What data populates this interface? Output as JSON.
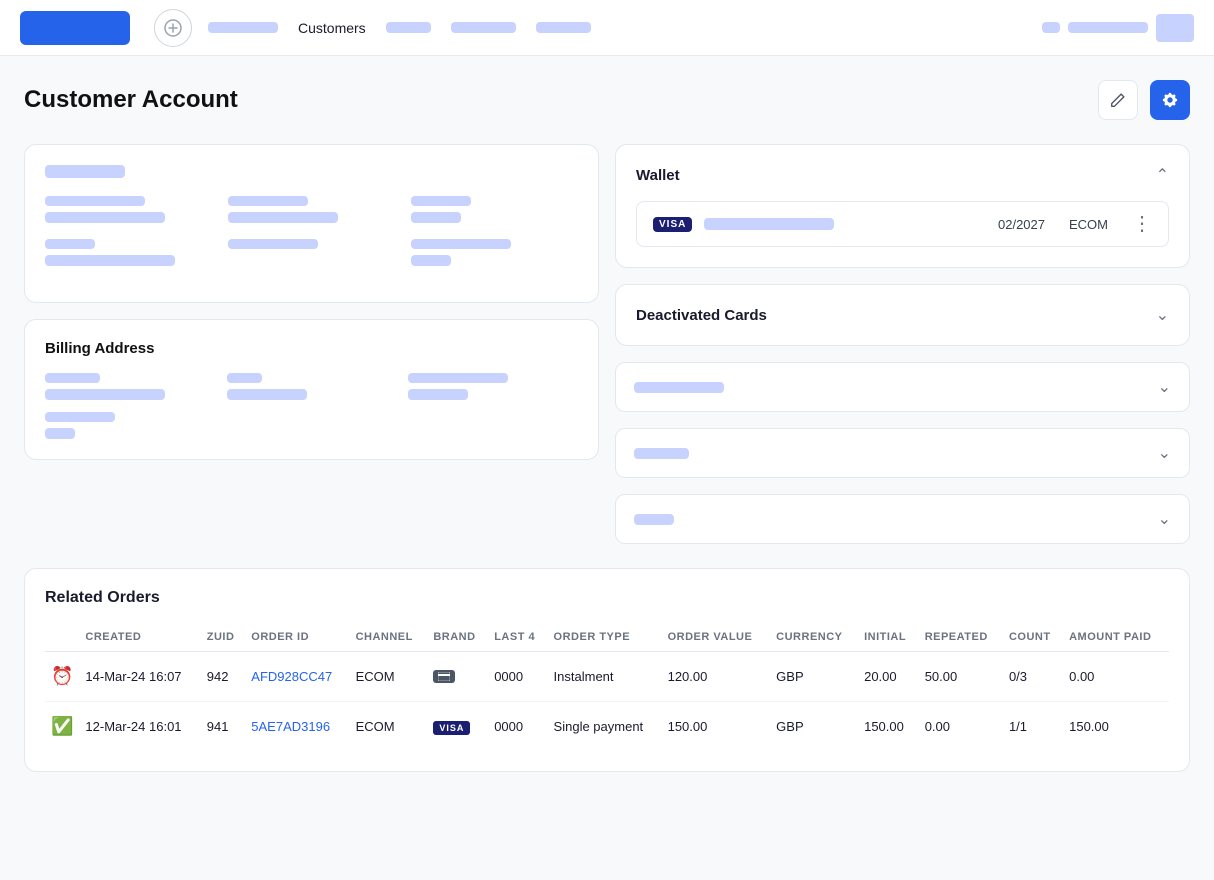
{
  "nav": {
    "add_label": "+",
    "active_item": "Customers",
    "item1_w": 70,
    "item2_w": 55,
    "item3_w": 65,
    "item4_w": 50,
    "right1_w": 70,
    "right2_w": 90
  },
  "page": {
    "title": "Customer Account",
    "edit_icon": "✏",
    "settings_icon": "⚙"
  },
  "wallet": {
    "title": "Wallet",
    "card": {
      "network": "VISA",
      "expiry": "02/2027",
      "type": "ECOM",
      "menu": "⋮"
    }
  },
  "deactivated": {
    "title": "Deactivated Cards"
  },
  "billing": {
    "title": "Billing Address"
  },
  "related_orders": {
    "title": "Related Orders",
    "columns": [
      "CREATED",
      "ZUID",
      "ORDER ID",
      "CHANNEL",
      "BRAND",
      "LAST 4",
      "ORDER TYPE",
      "ORDER VALUE",
      "CURRENCY",
      "INITIAL",
      "REPEATED",
      "COUNT",
      "AMOUNT PAID"
    ],
    "rows": [
      {
        "status": "pending",
        "created": "14-Mar-24 16:07",
        "zuid": "942",
        "order_id": "AFD928CC47",
        "channel": "ECOM",
        "brand": "card",
        "last4": "0000",
        "order_type": "Instalment",
        "order_value": "120.00",
        "currency": "GBP",
        "initial": "20.00",
        "repeated": "50.00",
        "count": "0/3",
        "amount_paid": "0.00"
      },
      {
        "status": "success",
        "created": "12-Mar-24 16:01",
        "zuid": "941",
        "order_id": "5AE7AD3196",
        "channel": "ECOM",
        "brand": "visa",
        "last4": "0000",
        "order_type": "Single payment",
        "order_value": "150.00",
        "currency": "GBP",
        "initial": "150.00",
        "repeated": "0.00",
        "count": "1/1",
        "amount_paid": "150.00"
      }
    ]
  }
}
